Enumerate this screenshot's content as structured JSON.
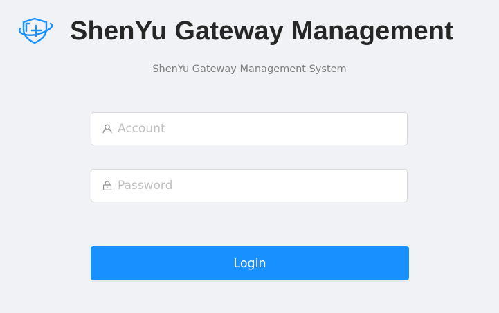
{
  "header": {
    "logo_icon": "shield-plus-icon",
    "title": "ShenYu Gateway Management",
    "subtitle": "ShenYu Gateway Management System"
  },
  "login_form": {
    "account": {
      "icon": "user-icon",
      "value": "",
      "placeholder": "Account"
    },
    "password": {
      "icon": "lock-icon",
      "value": "",
      "placeholder": "Password"
    },
    "submit_label": "Login"
  },
  "colors": {
    "background": "#f0f2f5",
    "primary": "#1890ff",
    "logo": "#1890ff",
    "title": "#262626",
    "subtitle": "#7f7f7f",
    "placeholder": "#bfbfbf"
  }
}
